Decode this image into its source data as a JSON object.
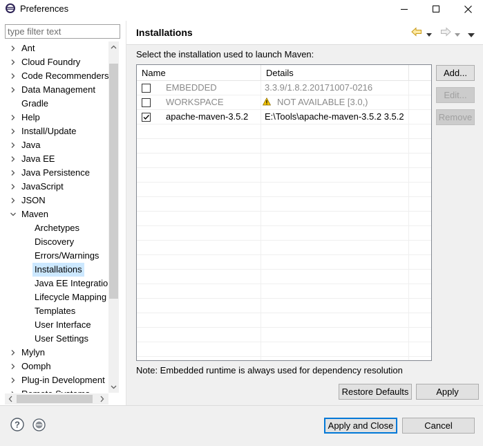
{
  "window": {
    "title": "Preferences",
    "icon": "eclipse-icon"
  },
  "filter": {
    "placeholder": "type filter text"
  },
  "tree": [
    {
      "label": "Ant",
      "level": 0,
      "expander": "collapsed"
    },
    {
      "label": "Cloud Foundry",
      "level": 0,
      "expander": "collapsed"
    },
    {
      "label": "Code Recommenders",
      "level": 0,
      "expander": "collapsed"
    },
    {
      "label": "Data Management",
      "level": 0,
      "expander": "collapsed"
    },
    {
      "label": "Gradle",
      "level": 0,
      "expander": "none"
    },
    {
      "label": "Help",
      "level": 0,
      "expander": "collapsed"
    },
    {
      "label": "Install/Update",
      "level": 0,
      "expander": "collapsed"
    },
    {
      "label": "Java",
      "level": 0,
      "expander": "collapsed"
    },
    {
      "label": "Java EE",
      "level": 0,
      "expander": "collapsed"
    },
    {
      "label": "Java Persistence",
      "level": 0,
      "expander": "collapsed"
    },
    {
      "label": "JavaScript",
      "level": 0,
      "expander": "collapsed"
    },
    {
      "label": "JSON",
      "level": 0,
      "expander": "collapsed"
    },
    {
      "label": "Maven",
      "level": 0,
      "expander": "expanded"
    },
    {
      "label": "Archetypes",
      "level": 1,
      "expander": "none"
    },
    {
      "label": "Discovery",
      "level": 1,
      "expander": "none"
    },
    {
      "label": "Errors/Warnings",
      "level": 1,
      "expander": "none"
    },
    {
      "label": "Installations",
      "level": 1,
      "expander": "none",
      "selected": true
    },
    {
      "label": "Java EE Integration",
      "level": 1,
      "expander": "none"
    },
    {
      "label": "Lifecycle Mapping",
      "level": 1,
      "expander": "none"
    },
    {
      "label": "Templates",
      "level": 1,
      "expander": "none"
    },
    {
      "label": "User Interface",
      "level": 1,
      "expander": "none"
    },
    {
      "label": "User Settings",
      "level": 1,
      "expander": "none"
    },
    {
      "label": "Mylyn",
      "level": 0,
      "expander": "collapsed"
    },
    {
      "label": "Oomph",
      "level": 0,
      "expander": "collapsed"
    },
    {
      "label": "Plug-in Development",
      "level": 0,
      "expander": "collapsed"
    },
    {
      "label": "Remote Systems",
      "level": 0,
      "expander": "collapsed"
    }
  ],
  "page": {
    "title": "Installations",
    "instruction": "Select the installation used to launch Maven:",
    "table": {
      "columns": [
        "Name",
        "Details"
      ],
      "rows": [
        {
          "name": "EMBEDDED",
          "details": "3.3.9/1.8.2.20171007-0216",
          "checked": false,
          "disabled": true,
          "warning": false
        },
        {
          "name": "WORKSPACE",
          "details": "NOT AVAILABLE [3.0,)",
          "checked": false,
          "disabled": true,
          "warning": true
        },
        {
          "name": "apache-maven-3.5.2",
          "details": "E:\\Tools\\apache-maven-3.5.2 3.5.2",
          "checked": true,
          "disabled": false,
          "warning": false
        }
      ]
    },
    "buttons": {
      "add": "Add...",
      "edit": "Edit...",
      "remove": "Remove"
    },
    "note": "Note: Embedded runtime is always used for dependency resolution",
    "restore_defaults": "Restore Defaults",
    "apply": "Apply"
  },
  "footer": {
    "apply_and_close": "Apply and Close",
    "cancel": "Cancel"
  },
  "colors": {
    "selection": "#cce8ff",
    "default_button_border": "#0078d7",
    "warning": "#f4c400"
  }
}
